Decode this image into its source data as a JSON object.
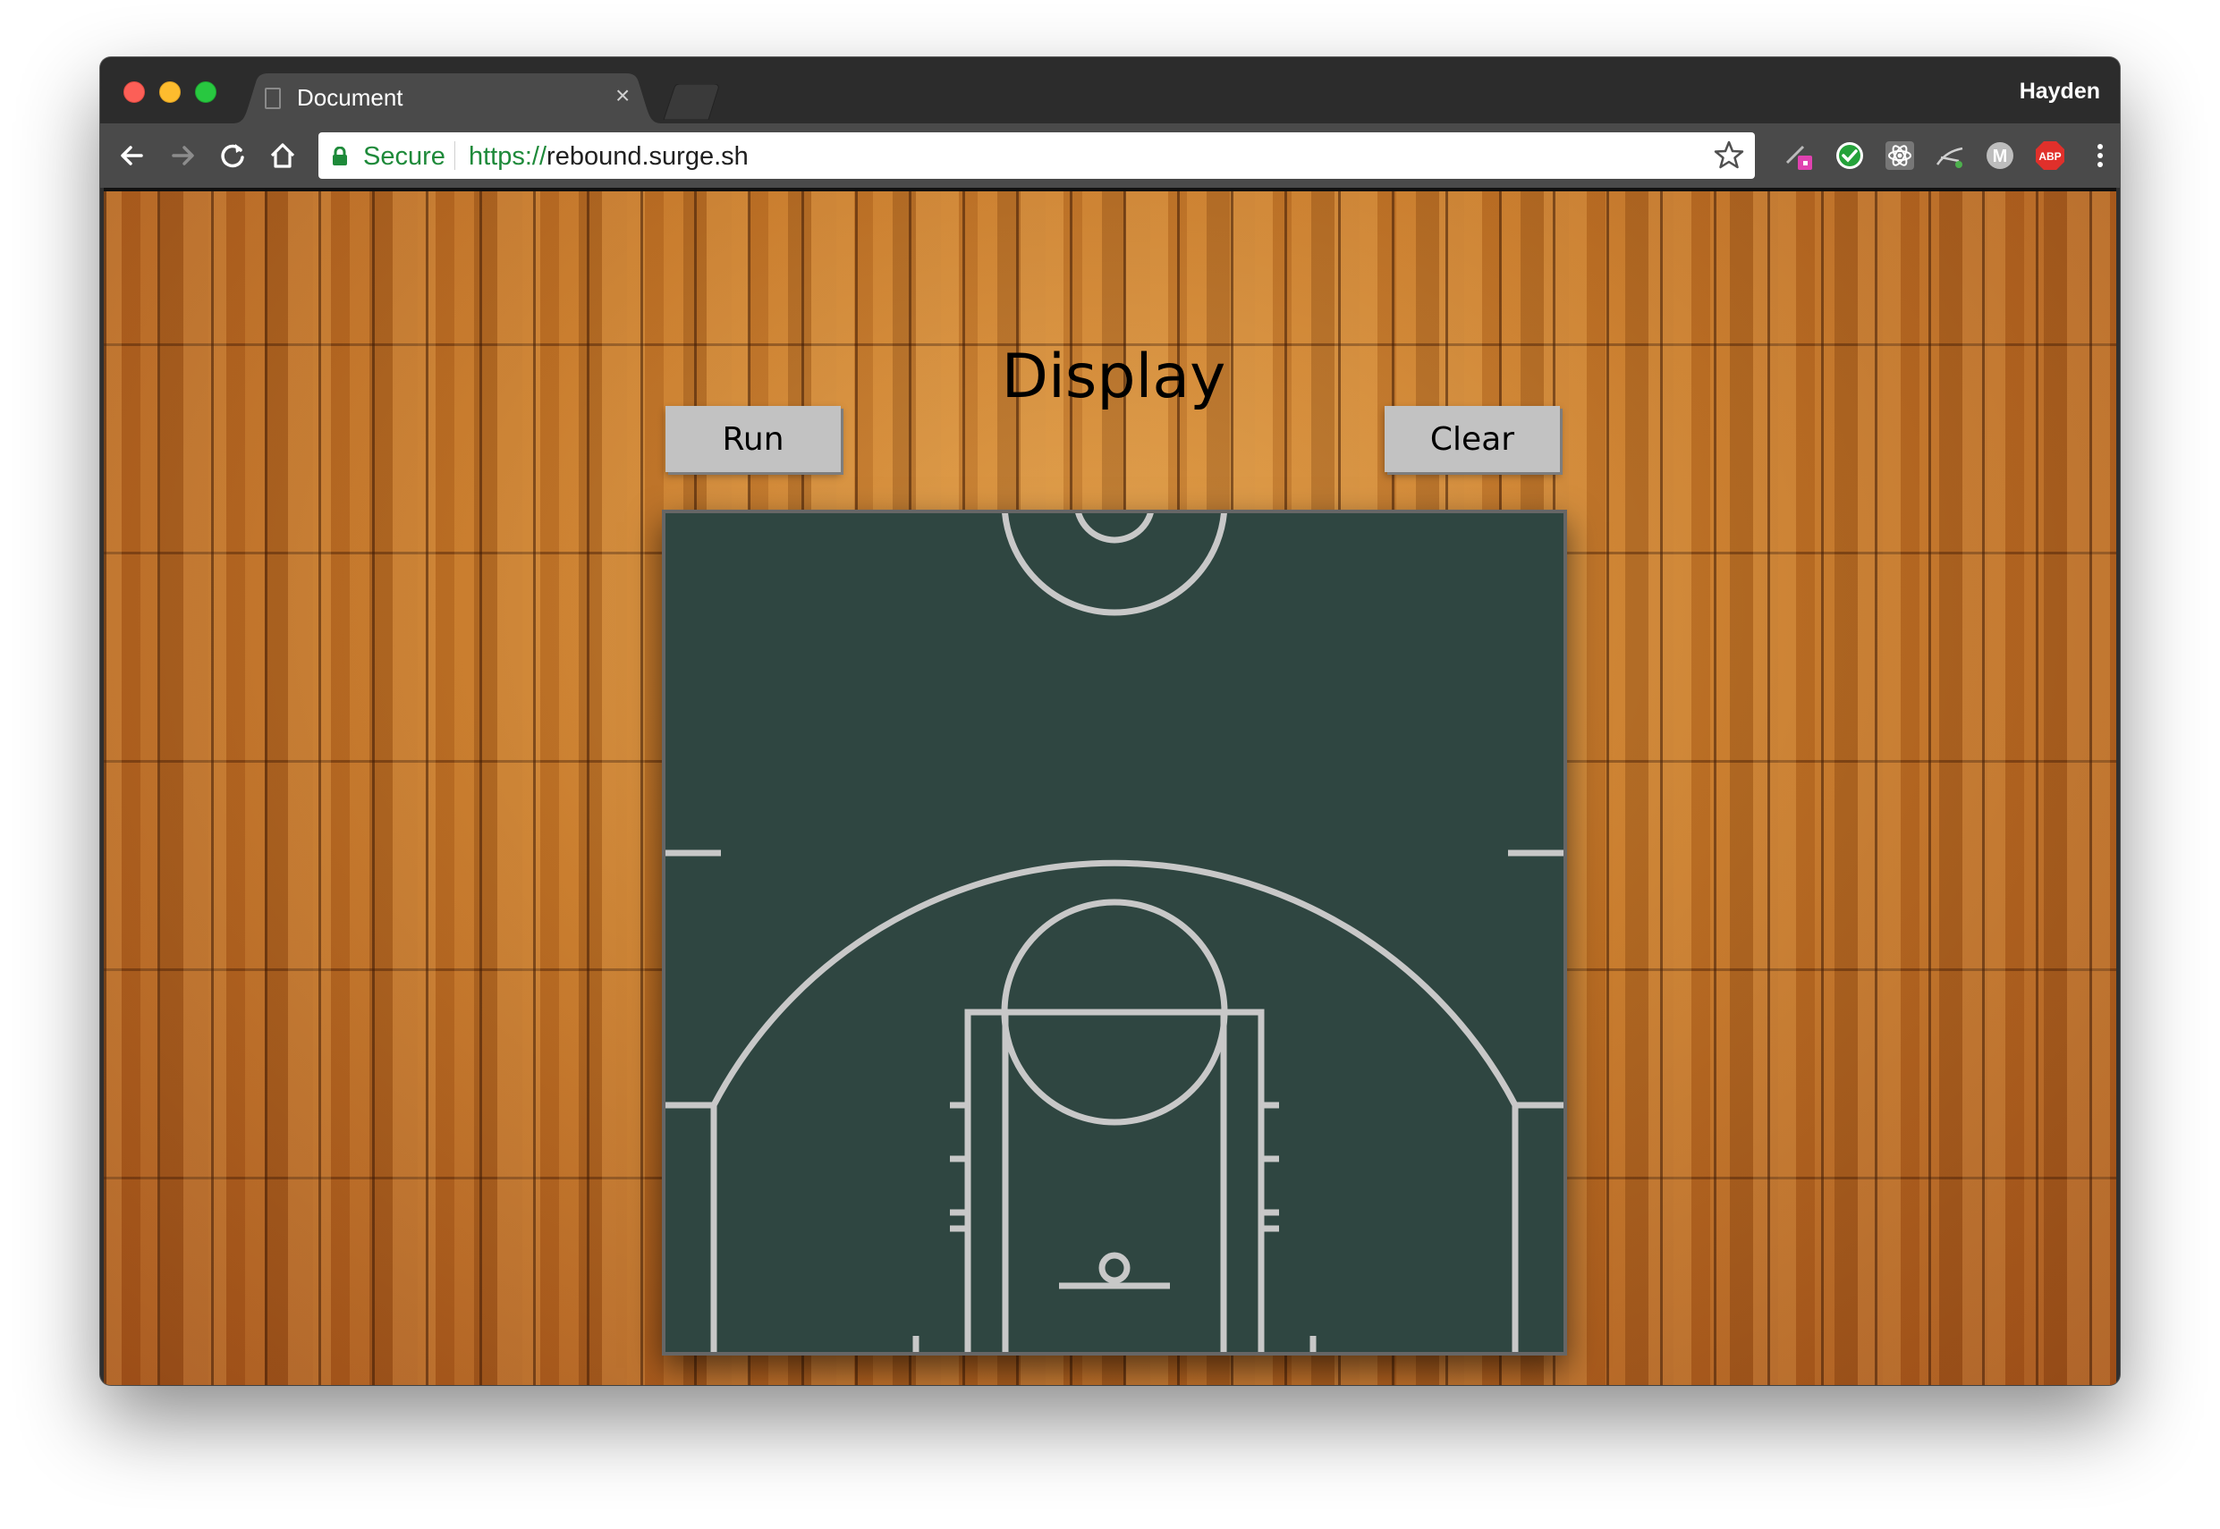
{
  "browser": {
    "tab_title": "Document",
    "tab_close": "×",
    "profile_name": "Hayden",
    "secure_label": "Secure",
    "url_scheme": "https://",
    "url_host": "rebound.surge.sh"
  },
  "toolbar": {
    "icons": [
      "back-icon",
      "forward-icon",
      "reload-icon",
      "home-icon"
    ],
    "extensions": [
      "pen-extension-icon",
      "check-extension-icon",
      "react-extension-icon",
      "network-extension-icon",
      "m-extension-icon",
      "adblock-plus-icon",
      "menu-icon"
    ],
    "adblock_label": "ABP",
    "m_label": "M"
  },
  "page": {
    "title": "Display",
    "run_label": "Run",
    "clear_label": "Clear"
  },
  "colors": {
    "court": "#2f4641",
    "court_lines": "#c8c8c8",
    "button": "#c2c2c2",
    "secure_green": "#1e8a3a"
  }
}
